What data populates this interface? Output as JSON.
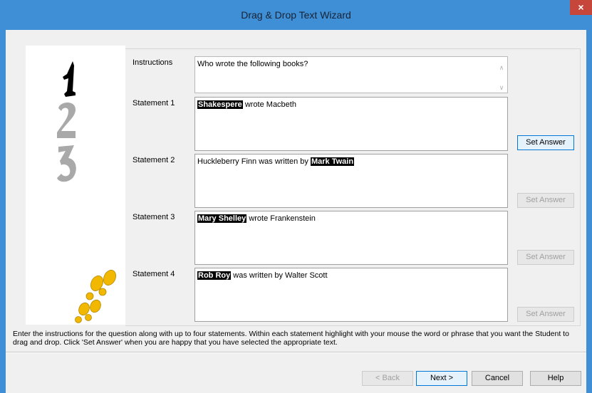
{
  "window": {
    "title": "Drag & Drop Text Wizard",
    "close_glyph": "×"
  },
  "icons": {
    "step_one": "number-one-icon",
    "step_two": "number-two-icon",
    "step_three": "number-three-icon",
    "footprints": "footprints-icon"
  },
  "colors": {
    "titlebar": "#3e8fd6",
    "close": "#c7463b",
    "highlight": "#000000",
    "footprints": "#f2b800"
  },
  "instructions": {
    "label": "Instructions",
    "value": "Who wrote the following books?"
  },
  "statements": [
    {
      "label": "Statement 1",
      "highlight": "Shakespere",
      "before": "",
      "after": " wrote Macbeth",
      "button": "Set Answer",
      "button_enabled": true
    },
    {
      "label": "Statement 2",
      "highlight": "Mark Twain",
      "before": "Huckleberry Finn was written by ",
      "after": "",
      "button": "Set Answer",
      "button_enabled": false
    },
    {
      "label": "Statement 3",
      "highlight": "Mary Shelley",
      "before": "",
      "after": " wrote Frankenstein",
      "button": "Set Answer",
      "button_enabled": false
    },
    {
      "label": "Statement 4",
      "highlight": "Rob Roy",
      "before": "",
      "after": " was written by Walter Scott",
      "button": "Set Answer",
      "button_enabled": false
    }
  ],
  "help_text": "Enter the instructions for the question along with up to four statements. Within each statement highlight with your mouse the word or phrase that you want the Student to drag and drop. Click 'Set Answer' when you are happy that you have selected the appropriate text.",
  "footer": {
    "back": "< Back",
    "next": "Next >",
    "cancel": "Cancel",
    "help": "Help"
  }
}
